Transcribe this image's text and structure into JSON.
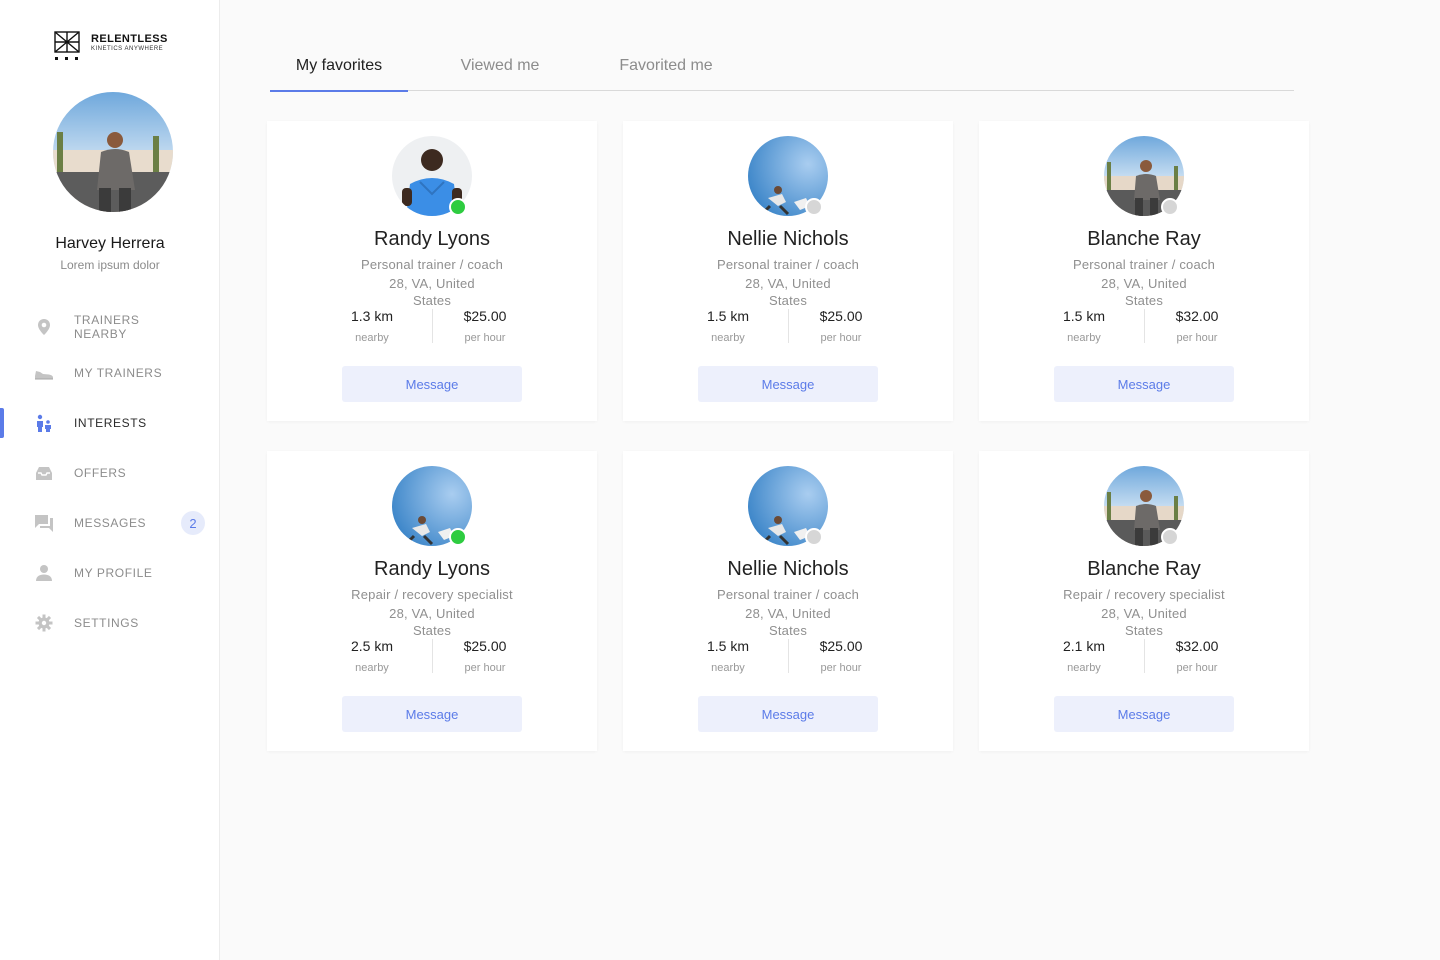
{
  "brand": {
    "title": "RELENTLESS",
    "subtitle": "KINETICS ANYWHERE"
  },
  "profile": {
    "name": "Harvey Herrera",
    "subtitle": "Lorem ipsum dolor"
  },
  "nav": [
    {
      "label": "TRAINERS NEARBY",
      "icon": "location-pin-icon",
      "active": false
    },
    {
      "label": "MY TRAINERS",
      "icon": "sneaker-icon",
      "active": false
    },
    {
      "label": "INTERESTS",
      "icon": "people-icon",
      "active": true
    },
    {
      "label": "OFFERS",
      "icon": "inbox-icon",
      "active": false
    },
    {
      "label": "MESSAGES",
      "icon": "chat-icon",
      "active": false,
      "badge": "2"
    },
    {
      "label": "MY PROFILE",
      "icon": "person-icon",
      "active": false
    },
    {
      "label": "SETTINGS",
      "icon": "gear-icon",
      "active": false
    }
  ],
  "tabs": [
    {
      "label": "My favorites",
      "active": true
    },
    {
      "label": "Viewed me",
      "active": false
    },
    {
      "label": "Favorited me",
      "active": false
    }
  ],
  "colors": {
    "accent": "#5b7be8",
    "online": "#2ecc40",
    "offline": "#d6d6d6",
    "button_bg": "#edf0fc"
  },
  "trainers": [
    {
      "name": "Randy Lyons",
      "role": "Personal trainer / coach",
      "location": "28, VA, United States",
      "distance": "1.3 km",
      "distance_label": "nearby",
      "price": "$25.00",
      "price_label": "per hour",
      "online": true,
      "button": "Message"
    },
    {
      "name": "Nellie Nichols",
      "role": "Personal trainer / coach",
      "location": "28, VA, United States",
      "distance": "1.5 km",
      "distance_label": "nearby",
      "price": "$25.00",
      "price_label": "per hour",
      "online": false,
      "button": "Message"
    },
    {
      "name": "Blanche Ray",
      "role": "Personal trainer / coach",
      "location": "28, VA, United States",
      "distance": "1.5 km",
      "distance_label": "nearby",
      "price": "$32.00",
      "price_label": "per hour",
      "online": false,
      "button": "Message"
    },
    {
      "name": "Randy Lyons",
      "role": "Repair / recovery specialist",
      "location": "28, VA, United States",
      "distance": "2.5 km",
      "distance_label": "nearby",
      "price": "$25.00",
      "price_label": "per hour",
      "online": true,
      "button": "Message"
    },
    {
      "name": "Nellie Nichols",
      "role": "Personal trainer / coach",
      "location": "28, VA, United States",
      "distance": "1.5 km",
      "distance_label": "nearby",
      "price": "$25.00",
      "price_label": "per hour",
      "online": false,
      "button": "Message"
    },
    {
      "name": "Blanche Ray",
      "role": "Repair / recovery specialist",
      "location": "28, VA, United States",
      "distance": "2.1 km",
      "distance_label": "nearby",
      "price": "$32.00",
      "price_label": "per hour",
      "online": false,
      "button": "Message"
    }
  ]
}
